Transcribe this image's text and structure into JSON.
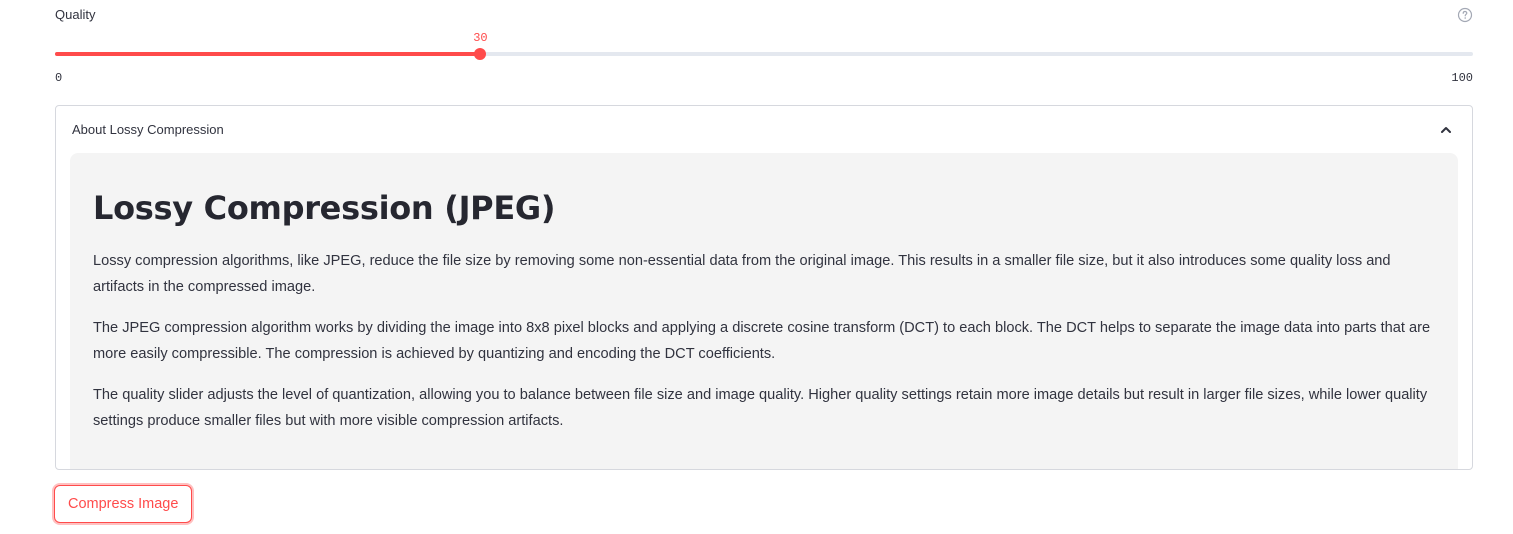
{
  "slider": {
    "label": "Quality",
    "value": 30,
    "value_text": "30",
    "min": 0,
    "max": 100,
    "min_text": "0",
    "max_text": "100",
    "help_icon": "question-circle-icon"
  },
  "expander": {
    "title": "About Lossy Compression",
    "expanded": true,
    "chevron_icon": "chevron-up-icon",
    "heading": "Lossy Compression (JPEG)",
    "paragraphs": [
      "Lossy compression algorithms, like JPEG, reduce the file size by removing some non-essential data from the original image. This results in a smaller file size, but it also introduces some quality loss and artifacts in the compressed image.",
      "The JPEG compression algorithm works by dividing the image into 8x8 pixel blocks and applying a discrete cosine transform (DCT) to each block. The DCT helps to separate the image data into parts that are more easily compressible. The compression is achieved by quantizing and encoding the DCT coefficients.",
      "The quality slider adjusts the level of quantization, allowing you to balance between file size and image quality. Higher quality settings retain more image details but result in larger file sizes, while lower quality settings produce smaller files but with more visible compression artifacts."
    ]
  },
  "button": {
    "label": "Compress Image"
  },
  "colors": {
    "accent": "#ff4b4b",
    "track": "#e4e8ef",
    "text": "#31333f",
    "content_bg": "#f4f4f4"
  }
}
